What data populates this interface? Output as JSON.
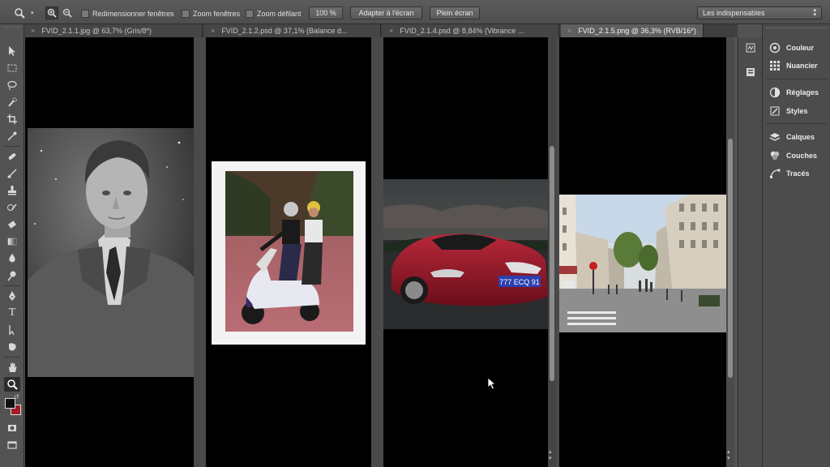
{
  "options_bar": {
    "zoom_tool_icon": "magnifier-icon",
    "chk_resize": "Redimensionner fenêtres",
    "chk_zoom_all": "Zoom fenêtres",
    "chk_scrubby": "Zoom défilant",
    "btn_100": "100 %",
    "btn_fit": "Adapter à l'écran",
    "btn_fill": "Plein écran",
    "workspace": "Les indispensables"
  },
  "tabs": [
    {
      "label": "FVID_2.1.1.jpg @ 63,7% (Gris/8*)"
    },
    {
      "label": "FVID_2.1.2.psd @ 37,1% (Balance d..."
    },
    {
      "label": "FVID_2.1.4.psd @ 8,84% (Vibrance ..."
    },
    {
      "label": "FVID_2.1.5.png @ 36,3% (RVB/16*)"
    }
  ],
  "plate_text": "777 ECQ 91",
  "panels": [
    {
      "label": "Couleur",
      "icon": "color-icon"
    },
    {
      "label": "Nuancier",
      "icon": "swatches-icon"
    },
    {
      "label": "Réglages",
      "icon": "adjustments-icon"
    },
    {
      "label": "Styles",
      "icon": "styles-icon"
    },
    {
      "label": "Calques",
      "icon": "layers-icon"
    },
    {
      "label": "Couches",
      "icon": "channels-icon"
    },
    {
      "label": "Tracés",
      "icon": "paths-icon"
    }
  ],
  "colors": {
    "foreground": "#111111",
    "background": "#a31c2a",
    "panel": "#4c4c4c",
    "canvas": "#000000"
  }
}
